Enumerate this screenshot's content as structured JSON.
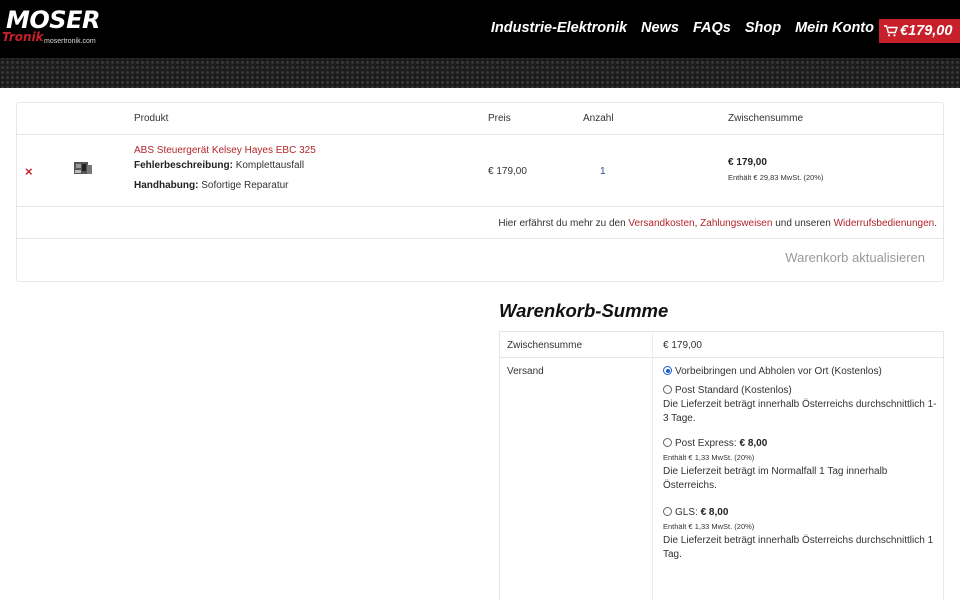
{
  "header": {
    "logo_main": "MOSER",
    "logo_sub": "Tronik",
    "logo_url": "mosertronik.com",
    "nav": [
      "Industrie-Elektronik",
      "News",
      "FAQs",
      "Shop",
      "Mein Konto"
    ],
    "cart_total": "€179,00",
    "cart_icon": "cart-icon",
    "brand_color": "#c8202a"
  },
  "cart": {
    "columns": {
      "product": "Produkt",
      "price": "Preis",
      "quantity": "Anzahl",
      "subtotal": "Zwischensumme"
    },
    "item": {
      "remove_icon": "×",
      "name": "ABS Steuergerät Kelsey Hayes EBC 325",
      "meta": [
        {
          "key": "Fehlerbeschreibung:",
          "value": "Komplettausfall"
        },
        {
          "key": "Handhabung:",
          "value": "Sofortige Reparatur"
        }
      ],
      "price": "€ 179,00",
      "quantity": "1",
      "subtotal": "€ 179,00",
      "subtotal_tax": "Enthält € 29,83 MwSt. (20%)"
    },
    "info": {
      "prefix": "Hier erfährst du mehr zu den ",
      "link1": "Versandkosten",
      "sep1": ", ",
      "link2": "Zahlungsweisen",
      "sep2": " und unseren ",
      "link3": "Widerrufsbedienungen",
      "suffix": "."
    },
    "update_button": "Warenkorb aktualisieren"
  },
  "totals": {
    "title": "Warenkorb-Summe",
    "subtotal_label": "Zwischensumme",
    "subtotal_value": "€ 179,00",
    "shipping_label": "Versand",
    "options": [
      {
        "label": "Vorbeibringen und Abholen vor Ort (Kostenlos)",
        "checked": true
      },
      {
        "label": "Post Standard (Kostenlos)",
        "note": "Die Lieferzeit beträgt innerhalb Österreichs durchschnittlich 1-3 Tage."
      },
      {
        "label": "Post Express:",
        "price": "€ 8,00",
        "tax": "Enthält € 1,33 MwSt. (20%)",
        "note": "Die Lieferzeit beträgt im Normalfall 1 Tag innerhalb Österreichs."
      },
      {
        "label": "GLS:",
        "price": "€ 8,00",
        "tax": "Enthält € 1,33 MwSt. (20%)",
        "note": "Die Lieferzeit beträgt innerhalb Österreichs durchschnittlich 1 Tag."
      }
    ]
  }
}
